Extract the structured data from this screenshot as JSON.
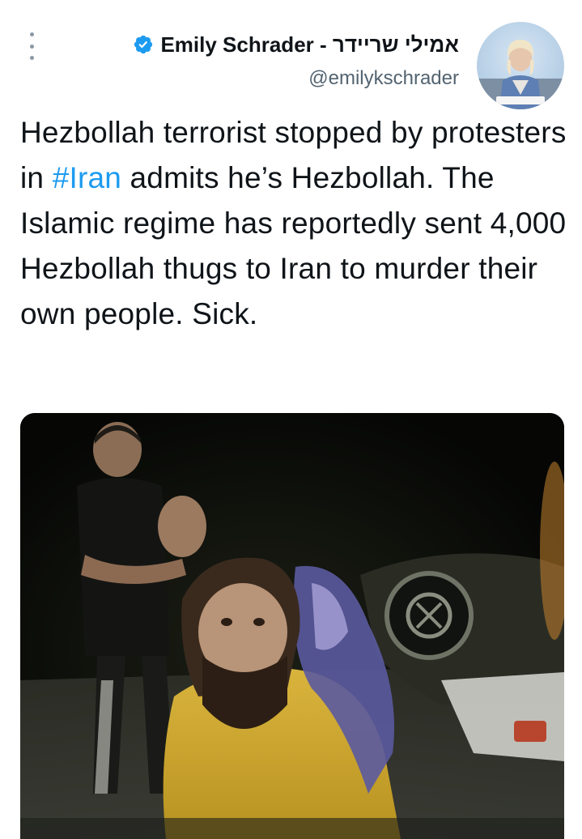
{
  "tweet": {
    "author_name": "Emily Schrader - אמילי שריידר",
    "handle": "@emilykschrader",
    "text_before": "Hezbollah terrorist stopped by protesters in ",
    "hashtag": "#Iran",
    "text_after": " admits he’s Hezbollah. The Islamic regime has reportedly sent 4,000 Hezbollah thugs to Iran to murder their own people. Sick."
  },
  "icons": {
    "more": "more-vertical-icon",
    "verified": "verified-badge-icon"
  },
  "colors": {
    "accent": "#1d9bf0",
    "text": "#0f1419",
    "secondary": "#536471"
  }
}
